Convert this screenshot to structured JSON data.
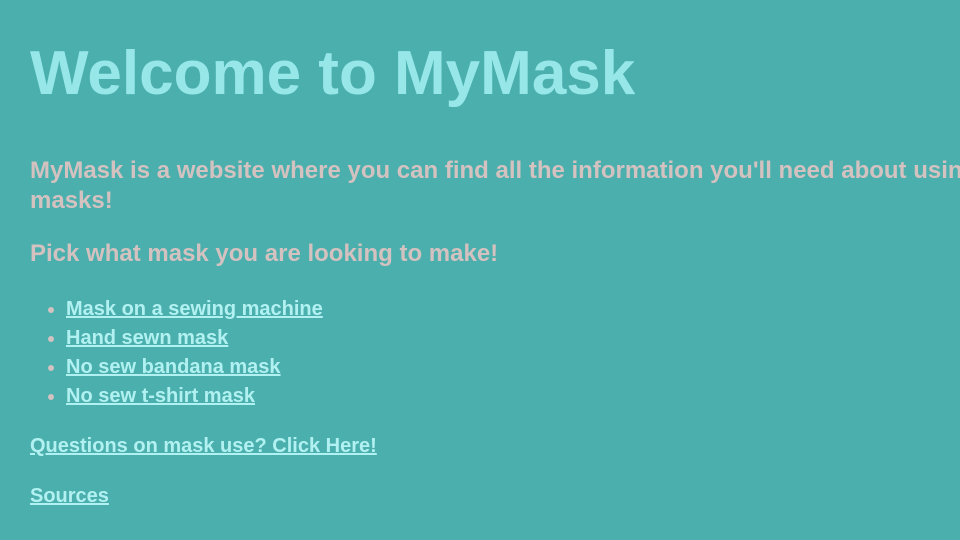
{
  "page": {
    "title": "Welcome to MyMask",
    "intro": "MyMask is a website where you can find all the information you'll need about using masks!",
    "pick_heading": "Pick what mask you are looking to make!"
  },
  "mask_links": [
    {
      "label": "Mask on a sewing machine"
    },
    {
      "label": "Hand sewn mask"
    },
    {
      "label": "No sew bandana mask"
    },
    {
      "label": "No sew t-shirt mask"
    }
  ],
  "links": {
    "questions": "Questions on mask use? Click Here!",
    "sources": "Sources"
  },
  "colors": {
    "background": "#4aafad",
    "title": "#97e7e9",
    "body_text": "#d3c2c0",
    "link": "#b2f1f1"
  }
}
